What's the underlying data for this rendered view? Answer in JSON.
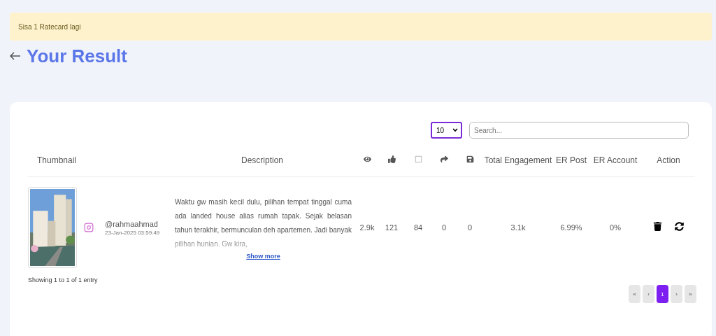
{
  "alert": {
    "text": "Sisa 1 Ratecard lagi"
  },
  "page": {
    "title": "Your Result"
  },
  "controls": {
    "page_size": "10",
    "search": {
      "placeholder": "Search..."
    }
  },
  "table": {
    "columns": [
      {
        "kind": "text",
        "label": "Thumbnail"
      },
      {
        "kind": "text",
        "label": "Description"
      },
      {
        "kind": "icon"
      },
      {
        "kind": "icon"
      },
      {
        "kind": "icon"
      },
      {
        "kind": "icon"
      },
      {
        "kind": "icon"
      },
      {
        "kind": "text",
        "label": "Total Engagement"
      },
      {
        "kind": "text",
        "label": "ER Post"
      },
      {
        "kind": "text",
        "label": "ER Account"
      },
      {
        "kind": "text",
        "label": "Action"
      }
    ],
    "rows": [
      {
        "username": "@rahmaahmad",
        "date": "23-Jan-2025 03:59:49",
        "description": "Waktu gw masih kecil dulu, pilihan tempat tinggal cuma ada landed house alias rumah tapak. Sejak belasan tahun terakhir, bermunculan deh apartemen. Jadi banyak pilihan hunian. Gw kira,",
        "show_more": "Show more",
        "views": "2.9k",
        "likes": "121",
        "comments": "84",
        "shares": "0",
        "saves": "0",
        "total_engagement": "3.1k",
        "er_post": "6.99%",
        "er_account": "0%"
      }
    ]
  },
  "footer": {
    "info": "Showing 1 to 1 of 1 entry",
    "pages": [
      {
        "label": "«",
        "selected": false
      },
      {
        "label": "‹",
        "selected": false
      },
      {
        "label": "1",
        "selected": true
      },
      {
        "label": "›",
        "selected": false
      },
      {
        "label": "»",
        "selected": false
      }
    ]
  }
}
